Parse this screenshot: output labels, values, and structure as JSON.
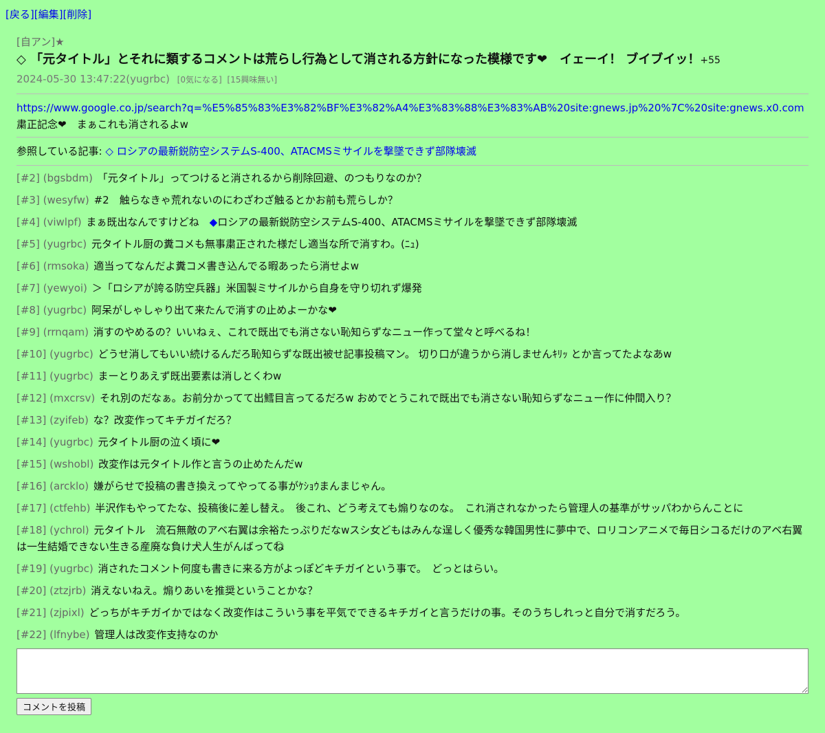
{
  "nav": {
    "back": "[戻る]",
    "edit": "[編集]",
    "delete": "[削除]"
  },
  "post": {
    "category": "[自アン]★",
    "title": "◇ 「元タイトル」とそれに類するコメントは荒らし行為として消される方針になった模様です❤　イェーイ！ ブイブイッ！",
    "score": "+55",
    "date": "2024-05-30 13:47:22(yugrbc)",
    "concerned": "[0気になる]",
    "not_interested": "[15興味無い]",
    "url": "https://www.google.co.jp/search?q=%E5%85%83%E3%82%BF%E3%82%A4%E3%83%88%E3%83%AB%20site:gnews.jp%20%7C%20site:gnews.x0.com",
    "body_text": "粛正記念❤　まぁこれも消されるよw",
    "refer_label": "参照している記事:",
    "refer_link": "◇ ロシアの最新鋭防空システムS-400、ATACMSミサイルを撃墜できず部隊壊滅"
  },
  "comments": [
    {
      "num": "[#2]",
      "uid": "(bgsbdm)",
      "text": "「元タイトル」ってつけると消されるから削除回避、のつもりなのか？"
    },
    {
      "num": "[#3]",
      "uid": "(wesyfw)",
      "text": "#2　触らなきゃ荒れないのにわざわざ触るとかお前も荒らしか？"
    },
    {
      "num": "[#4]",
      "uid": "(viwlpf)",
      "text": "まぁ既出なんですけどね　",
      "diamond": "◆",
      "text2": "ロシアの最新鋭防空システムS-400、ATACMSミサイルを撃墜できず部隊壊滅"
    },
    {
      "num": "[#5]",
      "uid": "(yugrbc)",
      "text": "元タイトル厨の糞コメも無事粛正された様だし適当な所で消すわ。(ﾆｭ)"
    },
    {
      "num": "[#6]",
      "uid": "(rmsoka)",
      "text": "適当ってなんだよ糞コメ書き込んでる暇あったら消せよw"
    },
    {
      "num": "[#7]",
      "uid": "(yewyoi)",
      "text": "＞「ロシアが誇る防空兵器」米国製ミサイルから自身を守り切れず爆発"
    },
    {
      "num": "[#8]",
      "uid": "(yugrbc)",
      "text": "阿呆がしゃしゃり出て来たんで消すの止めよーかな❤"
    },
    {
      "num": "[#9]",
      "uid": "(rrnqam)",
      "text": "消すのやめるの？いいねぇ、これで既出でも消さない恥知らずなニュー作って堂々と呼べるね！"
    },
    {
      "num": "[#10]",
      "uid": "(yugrbc)",
      "text": "どうせ消してもいい続けるんだろ恥知らずな既出被せ記事投稿マン。 切り口が違うから消しませんｷﾘｯ とか言ってたよなあw"
    },
    {
      "num": "[#11]",
      "uid": "(yugrbc)",
      "text": "まーとりあえず既出要素は消しとくわw"
    },
    {
      "num": "[#12]",
      "uid": "(mxcrsv)",
      "text": "それ別のだなぁ。お前分かってて出鱈目言ってるだろw おめでとうこれで既出でも消さない恥知らずなニュー作に仲間入り？"
    },
    {
      "num": "[#13]",
      "uid": "(zyifeb)",
      "text": "な？改変作ってキチガイだろ？"
    },
    {
      "num": "[#14]",
      "uid": "(yugrbc)",
      "text": "元タイトル厨の泣く頃に❤"
    },
    {
      "num": "[#15]",
      "uid": "(wshobl)",
      "text": "改変作は元タイトル作と言うの止めたんだw"
    },
    {
      "num": "[#16]",
      "uid": "(arcklo)",
      "text": "嫌がらせで投稿の書き換えってやってる事がｹｼｮｳまんまじゃん。"
    },
    {
      "num": "[#17]",
      "uid": "(ctfehb)",
      "text": "半沢作もやってたな、投稿後に差し替え。　後これ、どう考えても煽りなのな。　これ消されなかったら管理人の基準がサッパわからんことに"
    },
    {
      "num": "[#18]",
      "uid": "(ychrol)",
      "text": "元タイトル　流石無敵のアベ右翼は余裕たっぷりだなwスシ女どもはみんな逞しく優秀な韓国男性に夢中で、ロリコンアニメで毎日シコるだけのアベ右翼は一生結婚できない生きる産廃な負け犬人生がんばってね⃝"
    },
    {
      "num": "[#19]",
      "uid": "(yugrbc)",
      "text": "消されたコメント何度も書きに来る方がよっぽどキチガイという事で。　どっとはらい。"
    },
    {
      "num": "[#20]",
      "uid": "(ztzjrb)",
      "text": "消えないねえ。煽りあいを推奨ということかな？"
    },
    {
      "num": "[#21]",
      "uid": "(zjpixl)",
      "text": "どっちがキチガイかではなく改変作はこういう事を平気でできるキチガイと言うだけの事。そのうちしれっと自分で消すだろう。"
    },
    {
      "num": "[#22]",
      "uid": "(lfnybe)",
      "text": "管理人は改変作支持なのか"
    }
  ],
  "form": {
    "comment_value": "",
    "submit_label": "コメントを投稿"
  }
}
